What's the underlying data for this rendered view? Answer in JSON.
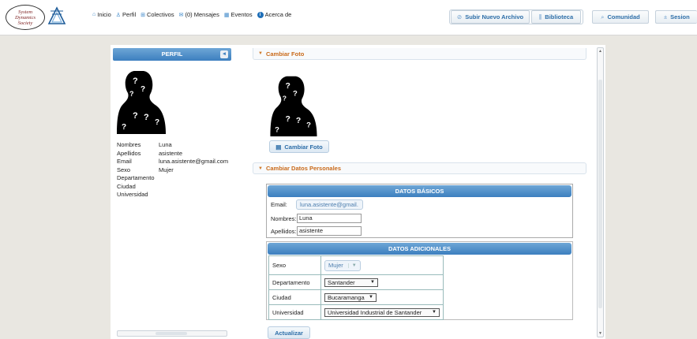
{
  "logo": {
    "line1": "System",
    "line2": "Dynamics",
    "line3": "Society"
  },
  "nav": [
    {
      "icon": "home-icon",
      "glyph": "⌂",
      "label": "Inicio"
    },
    {
      "icon": "user-icon",
      "glyph": "♙",
      "label": "Perfil"
    },
    {
      "icon": "group-icon",
      "glyph": "⊞",
      "label": "Colectivos"
    },
    {
      "icon": "mail-icon",
      "glyph": "✉",
      "label": "(0) Mensajes"
    },
    {
      "icon": "calendar-icon",
      "glyph": "▦",
      "label": "Eventos"
    },
    {
      "icon": "info-icon",
      "glyph": "i",
      "label": "Acerca de"
    }
  ],
  "toolbar": {
    "upload_label": "Subir Nuevo Archivo",
    "library_label": "Biblioteca",
    "community_label": "Comunidad",
    "session_label": "Sesion"
  },
  "perfil": {
    "title": "PERFIL",
    "rows": [
      {
        "k": "Nombres",
        "v": "Luna"
      },
      {
        "k": "Apellidos",
        "v": "asistente"
      },
      {
        "k": "Email",
        "v": "luna.asistente@gmail.com"
      },
      {
        "k": "Sexo",
        "v": "Mujer"
      },
      {
        "k": "Departamento",
        "v": ""
      },
      {
        "k": "Ciudad",
        "v": ""
      },
      {
        "k": "Universidad",
        "v": ""
      }
    ]
  },
  "photo_section": {
    "title": "Cambiar Foto",
    "button": "Cambiar Foto"
  },
  "personal_section": {
    "title": "Cambiar Datos Personales"
  },
  "basic": {
    "title": "DATOS BÁSICOS",
    "email_label": "Email:",
    "email_value": "luna.asistente@gmail.",
    "nombres_label": "Nombres:",
    "nombres_value": "Luna",
    "apellidos_label": "Apellidos:",
    "apellidos_value": "asistente"
  },
  "additional": {
    "title": "DATOS ADICIONALES",
    "sexo_label": "Sexo",
    "sexo_value": "Mujer",
    "departamento_label": "Departamento",
    "departamento_value": "Santander",
    "ciudad_label": "Ciudad",
    "ciudad_value": "Bucaramanga",
    "universidad_label": "Universidad",
    "universidad_value": "Universidad Industrial de Santander"
  },
  "update_button": "Actualizar",
  "colors": {
    "accent": "#3c7fbf",
    "section": "#c96a1a",
    "page_bg": "#e9e7e1"
  }
}
